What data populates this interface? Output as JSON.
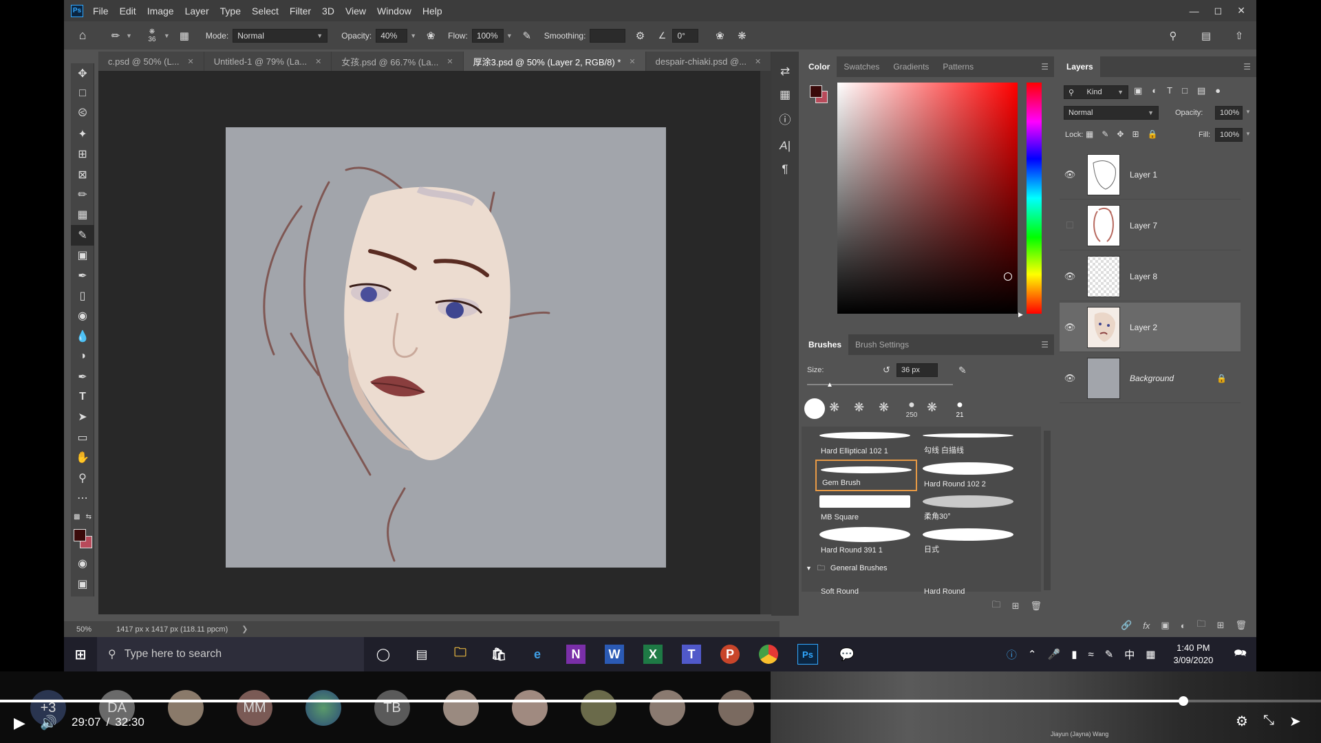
{
  "app": {
    "logo": "Ps",
    "menus": [
      "File",
      "Edit",
      "Image",
      "Layer",
      "Type",
      "Select",
      "Filter",
      "3D",
      "View",
      "Window",
      "Help"
    ]
  },
  "options": {
    "brush_size": "36",
    "mode_label": "Mode:",
    "mode_value": "Normal",
    "opacity_label": "Opacity:",
    "opacity_value": "40%",
    "flow_label": "Flow:",
    "flow_value": "100%",
    "smoothing_label": "Smoothing:",
    "smoothing_value": "",
    "angle_value": "0°"
  },
  "tabs": [
    {
      "label": "c.psd @ 50% (L...",
      "active": false
    },
    {
      "label": "Untitled-1 @ 79% (La...",
      "active": false
    },
    {
      "label": "女孩.psd @ 66.7% (La...",
      "active": false
    },
    {
      "label": "厚涂3.psd @ 50% (Layer 2, RGB/8) *",
      "active": true
    },
    {
      "label": "despair-chiaki.psd @...",
      "active": false
    }
  ],
  "status": {
    "zoom": "50%",
    "doc_info": "1417 px x 1417 px (118.11 ppcm)"
  },
  "color_panel": {
    "tabs": [
      "Color",
      "Swatches",
      "Gradients",
      "Patterns"
    ],
    "foreground": "#3a0a0a",
    "background": "#b84a5a"
  },
  "brushes_panel": {
    "tabs": [
      "Brushes",
      "Brush Settings"
    ],
    "size_label": "Size:",
    "size_value": "36 px",
    "preset_sizes": [
      "250",
      "21"
    ],
    "brushes": [
      {
        "name": "Hard Elliptical 102 1"
      },
      {
        "name": "勾线 白描线"
      },
      {
        "name": "Gem Brush",
        "selected": true
      },
      {
        "name": "Hard Round 102 2"
      },
      {
        "name": "MB Square"
      },
      {
        "name": "柔角30°"
      },
      {
        "name": "Hard Round 391 1"
      },
      {
        "name": "日式"
      }
    ],
    "group_name": "General Brushes",
    "group_brushes": [
      {
        "name": "Soft Round"
      },
      {
        "name": "Hard Round"
      }
    ]
  },
  "layers_panel": {
    "title": "Layers",
    "filter_label": "Kind",
    "blend_mode": "Normal",
    "opacity_label": "Opacity:",
    "opacity_value": "100%",
    "lock_label": "Lock:",
    "fill_label": "Fill:",
    "fill_value": "100%",
    "layers": [
      {
        "name": "Layer 1",
        "visible": true,
        "selected": false
      },
      {
        "name": "Layer 7",
        "visible": false,
        "selected": false
      },
      {
        "name": "Layer 8",
        "visible": true,
        "selected": false
      },
      {
        "name": "Layer 2",
        "visible": true,
        "selected": true
      },
      {
        "name": "Background",
        "visible": true,
        "selected": false,
        "locked": true
      }
    ]
  },
  "taskbar": {
    "search_placeholder": "Type here to search",
    "time": "1:40 PM",
    "date": "3/09/2020",
    "ime": "中"
  },
  "video": {
    "current_time": "29:07",
    "separator": "/",
    "total_time": "32:30",
    "progress": 0.896,
    "participants": [
      "+3",
      "DA",
      "",
      "MM",
      "",
      "TB",
      "",
      "",
      "",
      "",
      ""
    ],
    "speaker_name": "Jiayun (Jayna) Wang"
  }
}
